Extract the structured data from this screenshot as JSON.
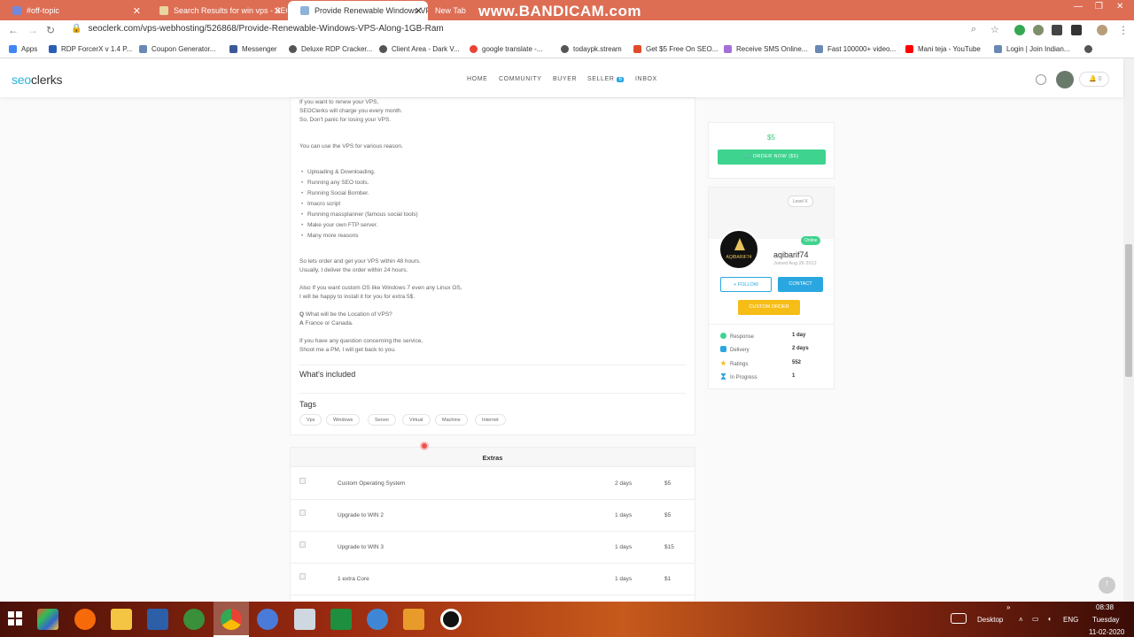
{
  "browser": {
    "tabs": [
      {
        "title": "#off-topic",
        "active": false
      },
      {
        "title": "Search Results for win vps - SEOC",
        "active": false
      },
      {
        "title": "Provide Renewable Windows VPS",
        "active": true
      },
      {
        "title": "New Tab",
        "active": false
      }
    ],
    "watermark": "www.BANDICAM.com",
    "url": "seoclerk.com/vps-webhosting/526868/Provide-Renewable-Windows-VPS-Along-1GB-Ram",
    "bookmarks": [
      "Apps",
      "RDP ForcerX v 1.4 P...",
      "Coupon Generator...",
      "Messenger",
      "Deluxe RDP Cracker...",
      "Client Area - Dark V...",
      "google translate -...",
      "todaypk.stream",
      "Get $5 Free On SEO...",
      "Receive SMS Online...",
      "Fast 100000+ video...",
      "Mani teja - YouTube",
      "Login | Join Indian..."
    ]
  },
  "site": {
    "logo_a": "seo",
    "logo_b": "clerks",
    "nav": [
      "HOME",
      "COMMUNITY",
      "BUYER",
      "SELLER",
      "INBOX"
    ],
    "seller_badge": "6",
    "bell_count": "0"
  },
  "description": {
    "lines_top": [
      "If you want to renew your VPS,",
      "SEOClerks will charge you every month.",
      "So, Don't panic for losing your VPS."
    ],
    "use_line": "You can use the VPS for various reason.",
    "bullets": [
      "Uploading & Downloading.",
      "Running any SEO tools.",
      "Running Social Bomber.",
      "Imacro script",
      "Running massplanner (famous social tools)",
      "Make your own FTP server.",
      "Many more reasons"
    ],
    "order_lines": [
      "So lets order and get your VPS within 48 hours.",
      "Usually, I deliver the order within 24 hours."
    ],
    "custom_os_lines": [
      "Also If you want custom OS like Windows 7 even any Linux OS,",
      "I will be happy to install it for you for extra 5$."
    ],
    "q_label": "Q",
    "q_text": " What will be the Location of VPS?",
    "a_label": "A",
    "a_text": " France or Canada.",
    "contact_lines": [
      "If you have any question concerning the service,",
      "Shoot me a PM, I will get back to you."
    ]
  },
  "included_title": "What's included",
  "tags_title": "Tags",
  "tags": [
    "Vps",
    "Windows",
    "Server",
    "Virtual",
    "Machine",
    "Internet"
  ],
  "extras": {
    "title": "Extras",
    "rows": [
      {
        "name": "Custom Operating System",
        "days": "2 days",
        "price": "$5"
      },
      {
        "name": "Upgrade to WIN 2",
        "days": "1 days",
        "price": "$5"
      },
      {
        "name": "Upgrade to WIN 3",
        "days": "1 days",
        "price": "$15"
      },
      {
        "name": "1 extra Core",
        "days": "1 days",
        "price": "$1"
      }
    ]
  },
  "order": {
    "price": "$5",
    "button": "ORDER NOW ($5)"
  },
  "seller": {
    "level": "Level X",
    "status": "Online",
    "avatar_text": "AQIBARIF74",
    "name": "aqibarif74",
    "joined": "Joined Aug 26 2012",
    "follow": "FOLLOW",
    "contact": "CONTACT",
    "custom_order": "CUSTOM ORDER",
    "stats": [
      {
        "label": "Response",
        "value": "1 day"
      },
      {
        "label": "Delivery",
        "value": "2 days"
      },
      {
        "label": "Ratings",
        "value": "552"
      },
      {
        "label": "In Progress",
        "value": "1"
      }
    ]
  },
  "taskbar": {
    "desktop": "Desktop",
    "lang": "ENG",
    "time": "08:38",
    "day": "Tuesday",
    "date": "11-02-2020"
  },
  "colors": {
    "accent_blue": "#2aa7e0",
    "order_green": "#3ed38e",
    "custom_yellow": "#f6bd17",
    "chrome_tab_bar": "#dd6e54"
  }
}
